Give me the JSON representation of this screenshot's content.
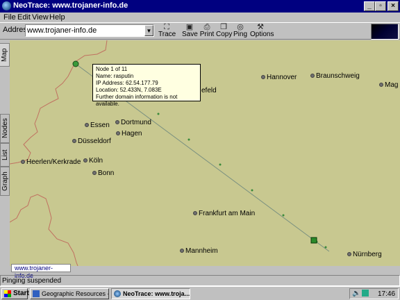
{
  "window": {
    "title": "NeoTrace: www.trojaner-info.de"
  },
  "menu": [
    "File",
    "Edit",
    "View",
    "Help"
  ],
  "toolbar": {
    "address_label": "Address",
    "address_value": "www.trojaner-info.de",
    "buttons": [
      "Trace",
      "Save",
      "Print",
      "Copy",
      "Ping",
      "Options"
    ]
  },
  "tabs": [
    "Map",
    "Nodes",
    "List",
    "Graph"
  ],
  "map": {
    "cities": [
      "Hannover",
      "Braunschweig",
      "Mag",
      "efeld",
      "Essen",
      "Dortmund",
      "Hagen",
      "Düsseldorf",
      "Heerlen/Kerkrade",
      "Köln",
      "Bonn",
      "Frankfurt am Main",
      "Mannheim",
      "Nürnberg"
    ],
    "tab_label": "www.trojaner-info.de"
  },
  "tooltip": {
    "lines": [
      "Node 1 of 11",
      "Name: rasputin",
      "IP Address: 62.54.177.79",
      "Location: 52.433N, 7.083E",
      "Further domain information is not available."
    ]
  },
  "status": {
    "text": "Pinging suspended"
  },
  "taskbar": {
    "start": "Start",
    "tasks": [
      "Geographic Resources - M...",
      "NeoTrace: www.troja..."
    ],
    "clock": "17:46"
  }
}
